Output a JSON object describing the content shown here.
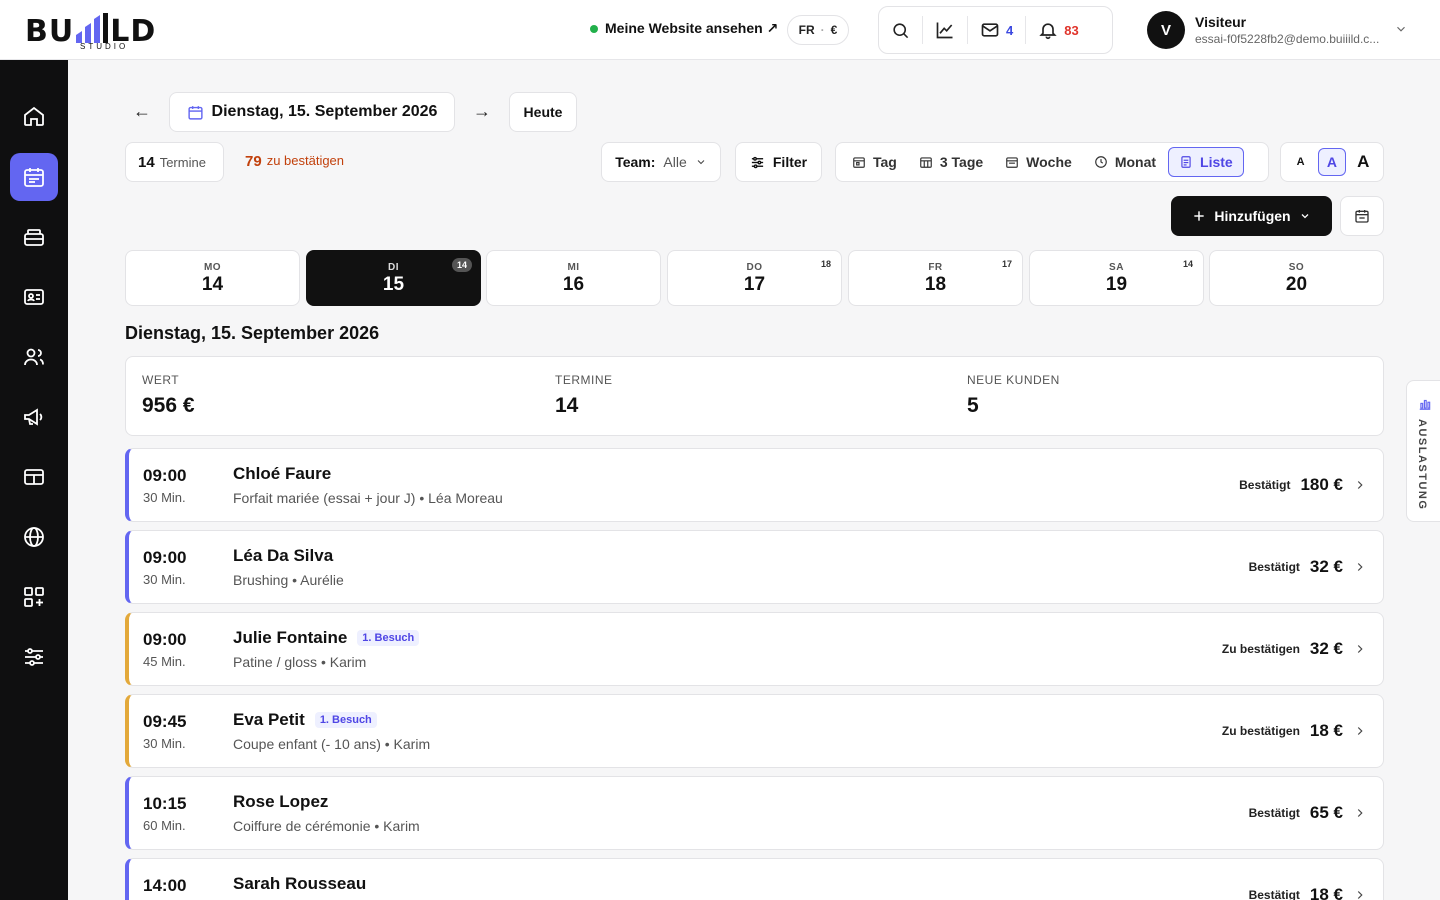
{
  "brand": {
    "logo_text_left": "BU",
    "logo_text_right": "LD",
    "logo_sub": "STUDIO"
  },
  "header": {
    "website_link": "Meine Website ansehen ↗",
    "lang": "FR",
    "currency": "€",
    "messages_count": "4",
    "notifications_count": "83",
    "user": {
      "initial": "V",
      "name": "Visiteur",
      "email": "essai-f0f5228fb2@demo.buiiild.c..."
    }
  },
  "nav": {
    "prev": "←",
    "next": "→",
    "date": "Dienstag, 15. September 2026",
    "today": "Heute"
  },
  "stats": {
    "appointments_count": "14",
    "appointments_label": "Termine",
    "pending_count": "79",
    "pending_label": "zu bestätigen"
  },
  "team": {
    "label": "Team:",
    "value": "Alle"
  },
  "filter_label": "Filter",
  "views": [
    "Tag",
    "3 Tage",
    "Woche",
    "Monat",
    "Liste"
  ],
  "sizes": [
    "A",
    "A",
    "A"
  ],
  "add_label": "Hinzufügen",
  "days": [
    {
      "abbr": "MO",
      "num": "14",
      "count": ""
    },
    {
      "abbr": "DI",
      "num": "15",
      "count": "14"
    },
    {
      "abbr": "MI",
      "num": "16",
      "count": ""
    },
    {
      "abbr": "DO",
      "num": "17",
      "count": "18"
    },
    {
      "abbr": "FR",
      "num": "18",
      "count": "17"
    },
    {
      "abbr": "SA",
      "num": "19",
      "count": "14"
    },
    {
      "abbr": "SO",
      "num": "20",
      "count": ""
    }
  ],
  "date_title": "Dienstag, 15. September 2026",
  "summary": [
    {
      "label": "WERT",
      "value": "956 €"
    },
    {
      "label": "TERMINE",
      "value": "14"
    },
    {
      "label": "NEUE KUNDEN",
      "value": "5"
    }
  ],
  "appointments": [
    {
      "time": "09:00",
      "duration": "30 Min.",
      "name": "Chloé Faure",
      "tag": "",
      "desc": "Forfait mariée (essai + jour J) • Léa Moreau",
      "status": "Bestätigt",
      "price": "180 €"
    },
    {
      "time": "09:00",
      "duration": "30 Min.",
      "name": "Léa Da Silva",
      "tag": "",
      "desc": "Brushing • Aurélie",
      "status": "Bestätigt",
      "price": "32 €"
    },
    {
      "time": "09:00",
      "duration": "45 Min.",
      "name": "Julie Fontaine",
      "tag": "1. Besuch",
      "desc": "Patine / gloss • Karim",
      "status": "Zu bestätigen",
      "price": "32 €"
    },
    {
      "time": "09:45",
      "duration": "30 Min.",
      "name": "Eva Petit",
      "tag": "1. Besuch",
      "desc": "Coupe enfant (- 10 ans) • Karim",
      "status": "Zu bestätigen",
      "price": "18 €"
    },
    {
      "time": "10:15",
      "duration": "60 Min.",
      "name": "Rose Lopez",
      "tag": "",
      "desc": "Coiffure de cérémonie • Karim",
      "status": "Bestätigt",
      "price": "65 €"
    },
    {
      "time": "14:00",
      "duration": "",
      "name": "Sarah Rousseau",
      "tag": "",
      "desc": "",
      "status": "Bestätigt",
      "price": "18 €"
    }
  ],
  "side_tab": "AUSLASTUNG"
}
